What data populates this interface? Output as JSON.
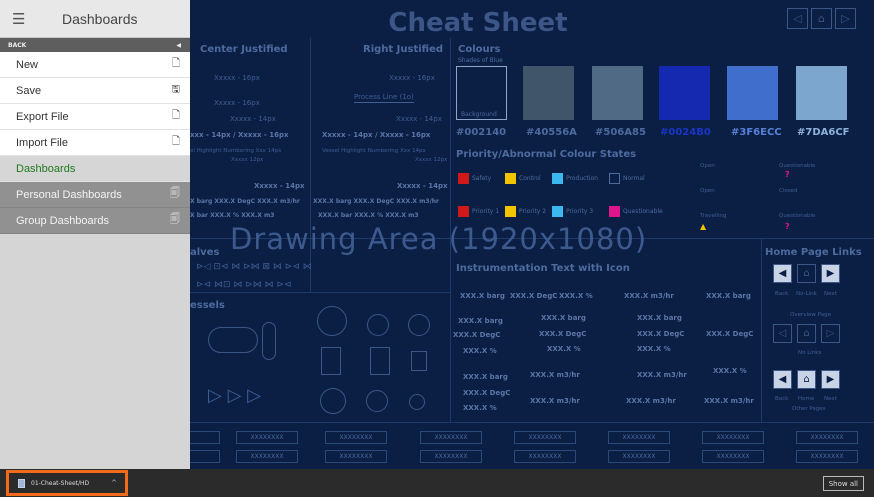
{
  "sidebar": {
    "title": "Dashboards",
    "back_label": "BACK",
    "items": [
      {
        "label": "New",
        "icon": "new-file-icon"
      },
      {
        "label": "Save",
        "icon": "save-icon"
      },
      {
        "label": "Export File",
        "icon": "export-file-icon"
      },
      {
        "label": "Import File",
        "icon": "import-file-icon"
      },
      {
        "label": "Dashboards",
        "icon": ""
      },
      {
        "label": "Personal Dashboards",
        "icon": "dashboard-folder-icon"
      },
      {
        "label": "Group Dashboards",
        "icon": "dashboard-folder-icon"
      }
    ]
  },
  "canvas": {
    "title": "Cheat Sheet",
    "drawing_area": "Drawing Area (1920x1080)",
    "center_justified": "Center Justified",
    "right_justified": "Right Justified",
    "process_line": "Process Line (1o)",
    "xxxxx_16": "Xxxxx - 16px",
    "xxxxx_14": "Xxxxx - 14px",
    "pair_16": "xxx - 14px  /  Xxxxx - 16px",
    "pair_16_r": "Xxxxx - 14px  /  Xxxxx - 16px",
    "vessel_num_l": "el Highlight Numbering Xxx  14px",
    "vessel_num_r": "Vessel Highlight Numbering Xxx  14px",
    "xxxxx_12": "Xxxxx 12px",
    "xxxxx_14b": "Xxxxx - 14px",
    "units_l": "X barg  XXX.X DegC  XXX.X m3/hr",
    "units_r": "XXX.X barg  XXX.X DegC  XXX.X m3/hr",
    "units2_l": "X bar  XXX.X %     XXX.X m3",
    "units2_r": "XXX.X bar  XXX.X %     XXX.X m3",
    "valves": "alves",
    "vessels": "essels",
    "colours": "Colours",
    "shades_of_blue": "Shades of Blue",
    "background_label": "Background",
    "hex_colors": [
      "#002140",
      "#40556A",
      "#506A85",
      "#0024B0",
      "#3F6ECC",
      "#7DA6CF"
    ],
    "swatch_colors": [
      "#0b1f44",
      "#40556a",
      "#506a85",
      "#1428b0",
      "#3f6ecc",
      "#7da6cf"
    ],
    "priority_title": "Priority/Abnormal Colour States",
    "priority_row1": [
      "Safety",
      "Control",
      "Production",
      "Normal"
    ],
    "priority_row1_colors": [
      "#d01818",
      "#f2c400",
      "#3cb8f0",
      "#0b1f44"
    ],
    "priority_row2": [
      "Priority 1",
      "Priority 2",
      "Priority 3",
      "Questionable"
    ],
    "priority_row2_colors": [
      "#d01818",
      "#f2c400",
      "#3cb8f0",
      "#e0158c"
    ],
    "state_labels": [
      "Open",
      "Questionable",
      "Open",
      "Closed",
      "Travelling",
      "Questionable"
    ],
    "instr_title": "Instrumentation Text with Icon",
    "instr_row1": [
      "XXX.X barg",
      "XXX.X DegC",
      "XXX.X %",
      "XXX.X m3/hr",
      "XXX.X barg"
    ],
    "instr_col1": [
      "XXX.X barg",
      "XXX.X DegC",
      "XXX.X %",
      "XXX.X barg",
      "XXX.X DegC",
      "XXX.X %"
    ],
    "instr_col2": [
      "XXX.X barg",
      "XXX.X DegC",
      "XXX.X %",
      "XXX.X m3/hr",
      "XXX.X m3/hr"
    ],
    "instr_col3": [
      "XXX.X barg",
      "XXX.X DegC",
      "XXX.X %",
      "XXX.X m3/hr",
      "XXX.X m3/hr"
    ],
    "instr_col4": [
      "XXX.X DegC",
      "XXX.X %",
      "XXX.X m3/hr"
    ],
    "home_links": "Home Page Links",
    "back_link": "Back",
    "no_link": "No-Link",
    "next_link": "Next",
    "overview_page": "Overview Page",
    "no_links": "No Links",
    "home": "Home",
    "other_pages": "Other Pages",
    "grid_cell": "XXXXXXXX"
  },
  "taskbar": {
    "item_label": "01-Cheat-Sheet/HD",
    "show_all": "Show all"
  }
}
